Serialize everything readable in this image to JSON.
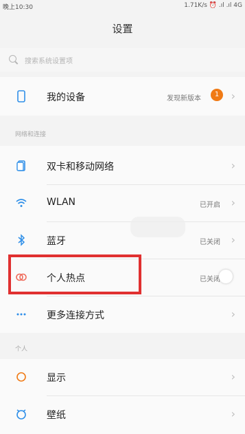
{
  "status_bar": {
    "time": "晚上10:30",
    "network": "1.71K/s ⏰ .ıl .ıl 4G"
  },
  "header": {
    "title": "设置"
  },
  "search": {
    "placeholder": "搜索系统设置项"
  },
  "device": {
    "label": "我的设备",
    "status": "发现新版本",
    "badge": "1"
  },
  "network_section": {
    "heading": "网络和连接",
    "items": [
      {
        "label": "双卡和移动网络",
        "value": ""
      },
      {
        "label": "WLAN",
        "value": "已开启"
      },
      {
        "label": "蓝牙",
        "value": "已关闭"
      },
      {
        "label": "个人热点",
        "value": "已关闭"
      },
      {
        "label": "更多连接方式",
        "value": ""
      }
    ]
  },
  "personal_section": {
    "heading": "个人",
    "items": [
      {
        "label": "显示"
      },
      {
        "label": "壁纸"
      }
    ]
  },
  "colors": {
    "accent": "#f07a15",
    "highlight_box": "#e03030",
    "icon_blue": "#2f8fe8",
    "hotspot_icon": "#ef6b5b"
  }
}
